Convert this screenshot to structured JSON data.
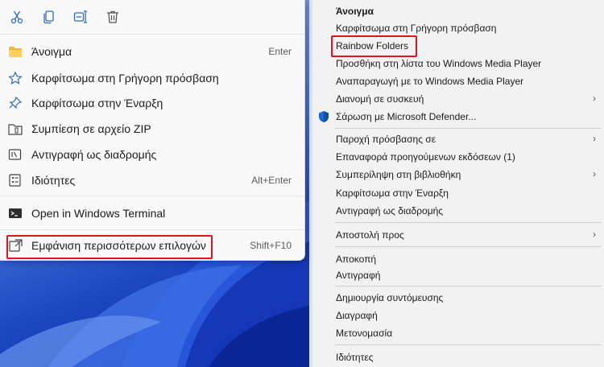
{
  "quick_actions": [
    {
      "name": "cut",
      "icon": "scissors-icon"
    },
    {
      "name": "copy",
      "icon": "copy-icon"
    },
    {
      "name": "rename",
      "icon": "rename-icon"
    },
    {
      "name": "delete",
      "icon": "trash-icon"
    }
  ],
  "modern_menu": {
    "items": [
      {
        "label": "Άνοιγμα",
        "shortcut": "Enter",
        "icon": "folder-icon"
      },
      {
        "label": "Καρφίτσωμα στη Γρήγορη πρόσβαση",
        "shortcut": "",
        "icon": "star-icon"
      },
      {
        "label": "Καρφίτσωμα στην Έναρξη",
        "shortcut": "",
        "icon": "pin-icon"
      },
      {
        "label": "Συμπίεση σε αρχείο ZIP",
        "shortcut": "",
        "icon": "zip-icon"
      },
      {
        "label": "Αντιγραφή ως διαδρομής",
        "shortcut": "",
        "icon": "copy-path-icon"
      },
      {
        "label": "Ιδιότητες",
        "shortcut": "Alt+Enter",
        "icon": "properties-icon"
      },
      {
        "label": "Open in Windows Terminal",
        "shortcut": "",
        "icon": "terminal-icon"
      },
      {
        "label": "Εμφάνιση περισσότερων επιλογών",
        "shortcut": "Shift+F10",
        "icon": "more-options-icon"
      }
    ]
  },
  "classic_menu": {
    "items": [
      {
        "label": "Άνοιγμα",
        "bold": true,
        "submenu": false
      },
      {
        "label": "Καρφίτσωμα στη Γρήγορη πρόσβαση",
        "submenu": false
      },
      {
        "label": "Rainbow Folders",
        "submenu": false
      },
      {
        "label": "Προσθήκη στη λίστα του Windows Media Player",
        "submenu": false
      },
      {
        "label": "Αναπαραγωγή με το Windows Media Player",
        "submenu": false
      },
      {
        "label": "Διανομή σε συσκευή",
        "submenu": true
      },
      {
        "label": "Σάρωση με Microsoft Defender...",
        "submenu": false,
        "icon": "shield-icon"
      },
      {
        "label": "Παροχή πρόσβασης σε",
        "submenu": true
      },
      {
        "label": "Επαναφορά προηγούμενων εκδόσεων (1)",
        "submenu": false
      },
      {
        "label": "Συμπερίληψη στη βιβλιοθήκη",
        "submenu": true
      },
      {
        "label": "Καρφίτσωμα στην Έναρξη",
        "submenu": false
      },
      {
        "label": "Αντιγραφή ως διαδρομής",
        "submenu": false
      },
      {
        "label": "Αποστολή προς",
        "submenu": true
      },
      {
        "label": "Αποκοπή",
        "submenu": false
      },
      {
        "label": "Αντιγραφή",
        "submenu": false
      },
      {
        "label": "Δημιουργία συντόμευσης",
        "submenu": false
      },
      {
        "label": "Διαγραφή",
        "submenu": false
      },
      {
        "label": "Μετονομασία",
        "submenu": false
      },
      {
        "label": "Ιδιότητες",
        "submenu": false
      }
    ],
    "arrow_glyph": "›"
  },
  "colors": {
    "highlight": "#e0141e",
    "accent": "#0067c0"
  }
}
